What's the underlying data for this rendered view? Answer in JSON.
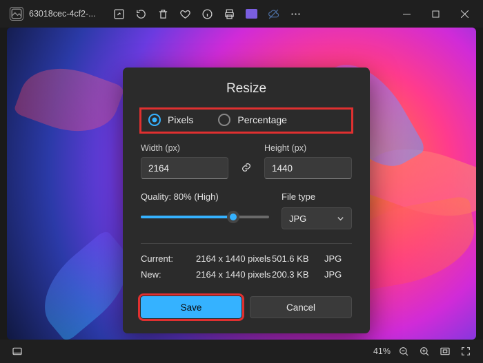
{
  "window": {
    "title": "63018cec-4cf2-..."
  },
  "dialog": {
    "title": "Resize",
    "radio": {
      "pixels": "Pixels",
      "percentage": "Percentage"
    },
    "width_label": "Width (px)",
    "height_label": "Height (px)",
    "width_value": "2164",
    "height_value": "1440",
    "quality_label": "Quality: 80% (High)",
    "quality_percent": 80,
    "filetype_label": "File type",
    "filetype_value": "JPG",
    "info": {
      "current_label": "Current:",
      "new_label": "New:",
      "current_dims": "2164 x 1440 pixels",
      "new_dims": "2164 x 1440 pixels",
      "current_size": "501.6 KB",
      "new_size": "200.3 KB",
      "current_format": "JPG",
      "new_format": "JPG"
    },
    "save": "Save",
    "cancel": "Cancel"
  },
  "status": {
    "zoom": "41%"
  }
}
